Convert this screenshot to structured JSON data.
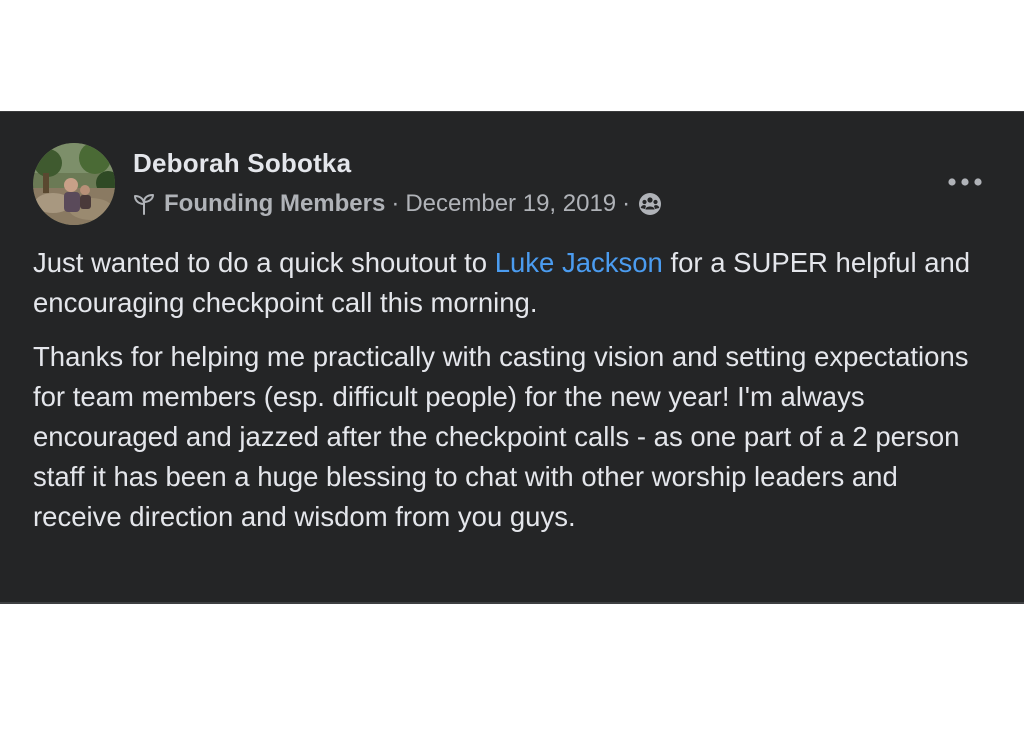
{
  "post": {
    "author": "Deborah Sobotka",
    "group_badge_icon": "sprout-icon",
    "group_name": "Founding Members",
    "separator": "·",
    "date": "December 19, 2019",
    "privacy_icon": "members-icon",
    "more_icon": "more-horizontal-icon",
    "paragraph1": {
      "before": "Just wanted to do a quick shoutout to ",
      "mention": "Luke Jackson",
      "after": " for a SUPER helpful and encouraging checkpoint call this morning."
    },
    "paragraph2": "Thanks for helping me practically with casting vision and setting expectations for team members (esp. difficult people) for the new year! I'm always encouraged and jazzed after the checkpoint calls - as one part of a 2 person staff it has been a huge blessing to chat with other worship leaders and receive direction and wisdom from you guys."
  },
  "colors": {
    "card_background": "#242526",
    "primary_text": "#e4e6eb",
    "secondary_text": "#b0b3b8",
    "mention_link": "#4b9cf0",
    "page_background": "#ffffff"
  }
}
